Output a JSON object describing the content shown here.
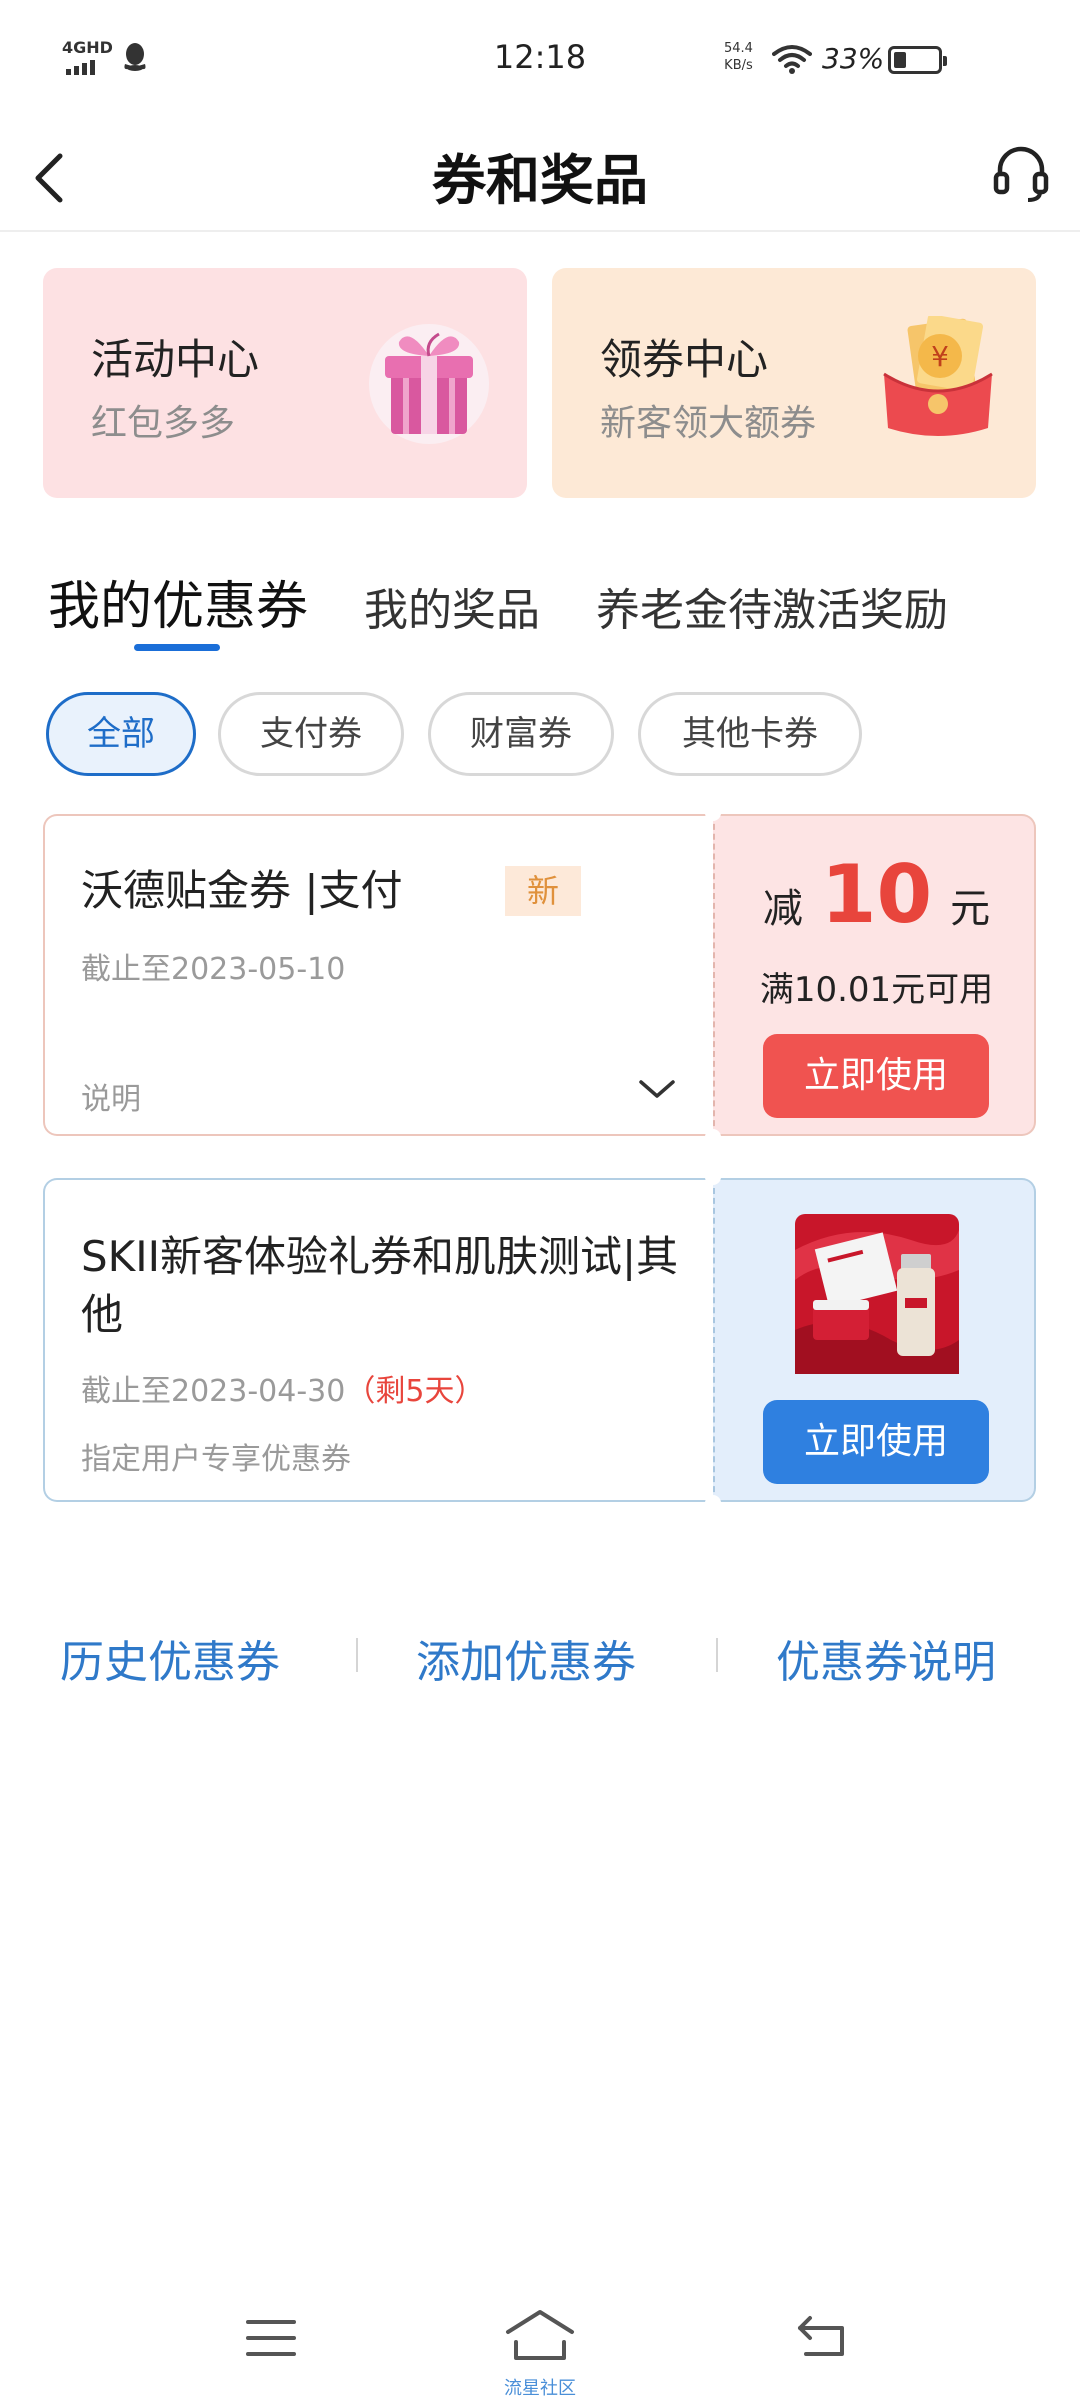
{
  "status_bar": {
    "network": "4GHD",
    "time": "12:18",
    "speed_value": "54.4",
    "speed_unit": "KB/s",
    "battery": "33%"
  },
  "header": {
    "title": "券和奖品"
  },
  "top_cards": [
    {
      "title": "活动中心",
      "subtitle": "红包多多",
      "icon": "gift-icon"
    },
    {
      "title": "领券中心",
      "subtitle": "新客领大额券",
      "icon": "red-envelope-icon"
    }
  ],
  "tabs": [
    {
      "label": "我的优惠券",
      "active": true
    },
    {
      "label": "我的奖品",
      "active": false
    },
    {
      "label": "养老金待激活奖励",
      "active": false
    }
  ],
  "filters": [
    {
      "label": "全部",
      "active": true
    },
    {
      "label": "支付券",
      "active": false
    },
    {
      "label": "财富券",
      "active": false
    },
    {
      "label": "其他卡券",
      "active": false
    }
  ],
  "coupons": [
    {
      "name": "沃德贴金券 |支付",
      "badge": "新",
      "expire": "截止至2023-05-10",
      "note": "说明",
      "amount_prefix": "减",
      "amount": "10",
      "amount_unit": "元",
      "condition": "满10.01元可用",
      "button": "立即使用"
    },
    {
      "name": "SKII新客体验礼券和肌肤测试|其他",
      "expire": "截止至2023-04-30",
      "remaining": "（剩5天）",
      "note": "指定用户专享优惠券",
      "button": "立即使用"
    }
  ],
  "links": [
    {
      "label": "历史优惠券"
    },
    {
      "label": "添加优惠券"
    },
    {
      "label": "优惠券说明"
    }
  ],
  "nav": {
    "home_label": "流星社区"
  },
  "colors": {
    "accent_blue": "#2f80e0",
    "accent_red": "#e8453c",
    "link_blue": "#2f79c9"
  }
}
